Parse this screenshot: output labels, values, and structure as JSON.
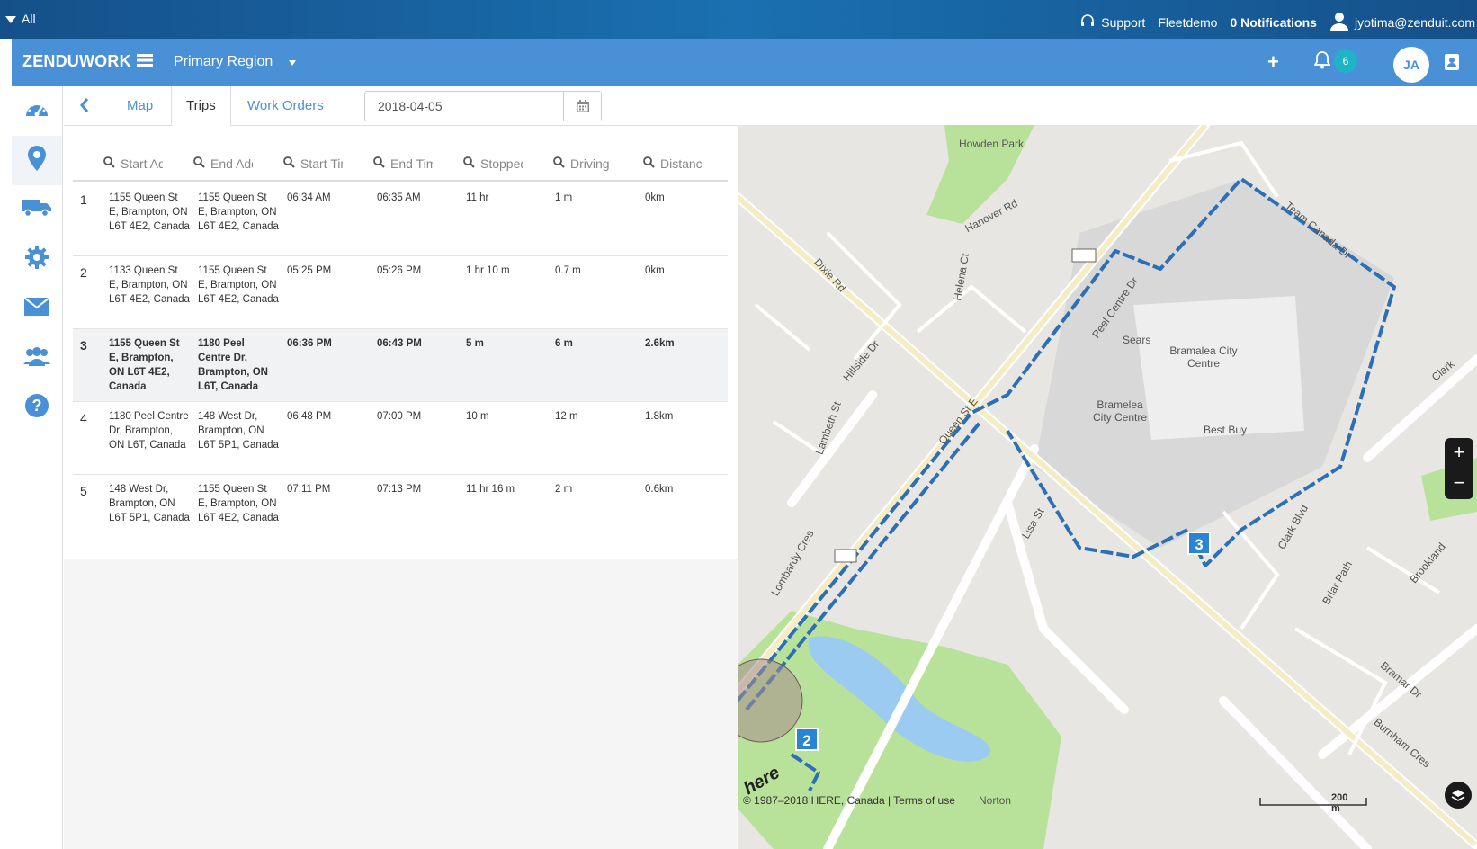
{
  "topbar": {
    "filter_label": "All",
    "support": "Support",
    "account": "Fleetdemo",
    "notifications": "0 Notifications",
    "user_email": "jyotima@zenduit.com"
  },
  "appbar": {
    "brand": "ZENDUWORK",
    "region": "Primary Region",
    "notif_count": "6",
    "avatar_initials": "JA"
  },
  "sidebar": {
    "items": [
      "dashboard-icon",
      "map-marker-icon",
      "truck-icon",
      "gear-icon",
      "envelope-icon",
      "users-icon",
      "help-icon"
    ]
  },
  "tabs": {
    "map": "Map",
    "trips": "Trips",
    "work_orders": "Work Orders",
    "date": "2018-04-05"
  },
  "table": {
    "columns": [
      "Start Addre",
      "End Addres",
      "Start Time",
      "End Time",
      "Stopped",
      "Driving",
      "Distance"
    ],
    "rows": [
      {
        "num": "1",
        "start": "1155 Queen St E, Brampton, ON L6T 4E2, Canada",
        "end": "1155 Queen St E, Brampton, ON L6T 4E2, Canada",
        "start_time": "06:34 AM",
        "end_time": "06:35 AM",
        "stopped": "11 hr",
        "driving": "1 m",
        "distance": "0km"
      },
      {
        "num": "2",
        "start": "1133 Queen St E, Brampton, ON L6T 4E2, Canada",
        "end": "1155 Queen St E, Brampton, ON L6T 4E2, Canada",
        "start_time": "05:25 PM",
        "end_time": "05:26 PM",
        "stopped": "1 hr 10 m",
        "driving": "0.7 m",
        "distance": "0km"
      },
      {
        "num": "3",
        "start": "1155 Queen St E, Brampton, ON L6T 4E2, Canada",
        "end": "1180 Peel Centre Dr, Brampton, ON L6T, Canada",
        "start_time": "06:36 PM",
        "end_time": "06:43 PM",
        "stopped": "5 m",
        "driving": "6 m",
        "distance": "2.6km"
      },
      {
        "num": "4",
        "start": "1180 Peel Centre Dr, Brampton, ON L6T, Canada",
        "end": "148 West Dr, Brampton, ON L6T 5P1, Canada",
        "start_time": "06:48 PM",
        "end_time": "07:00 PM",
        "stopped": "10 m",
        "driving": "12 m",
        "distance": "1.8km"
      },
      {
        "num": "5",
        "start": "148 West Dr, Brampton, ON L6T 5P1, Canada",
        "end": "1155 Queen St E, Brampton, ON L6T 4E2, Canada",
        "start_time": "07:11 PM",
        "end_time": "07:13 PM",
        "stopped": "11 hr 16 m",
        "driving": "2 m",
        "distance": "0.6km"
      }
    ]
  },
  "map": {
    "labels": [
      "Howden Park",
      "Hanover Rd",
      "Dixie Rd",
      "Helena Ct",
      "Hillside Dr",
      "Lambeth St",
      "Queen St E",
      "Peel Centre Dr",
      "Sears",
      "Bramalea City Centre",
      "Bramelea City Centre",
      "Best Buy",
      "Team Canada Dr",
      "Lisa St",
      "Lombardy Cres",
      "Clark Blvd",
      "Briar Path",
      "Brookland",
      "Bramar Dr",
      "Burnham Cres",
      "Norton",
      "Clark",
      "here"
    ],
    "markers": [
      "3",
      "2"
    ],
    "zoom_in": "+",
    "zoom_out": "−",
    "copyright": "© 1987–2018 HERE, Canada | Terms of use",
    "scale": "200 m"
  }
}
